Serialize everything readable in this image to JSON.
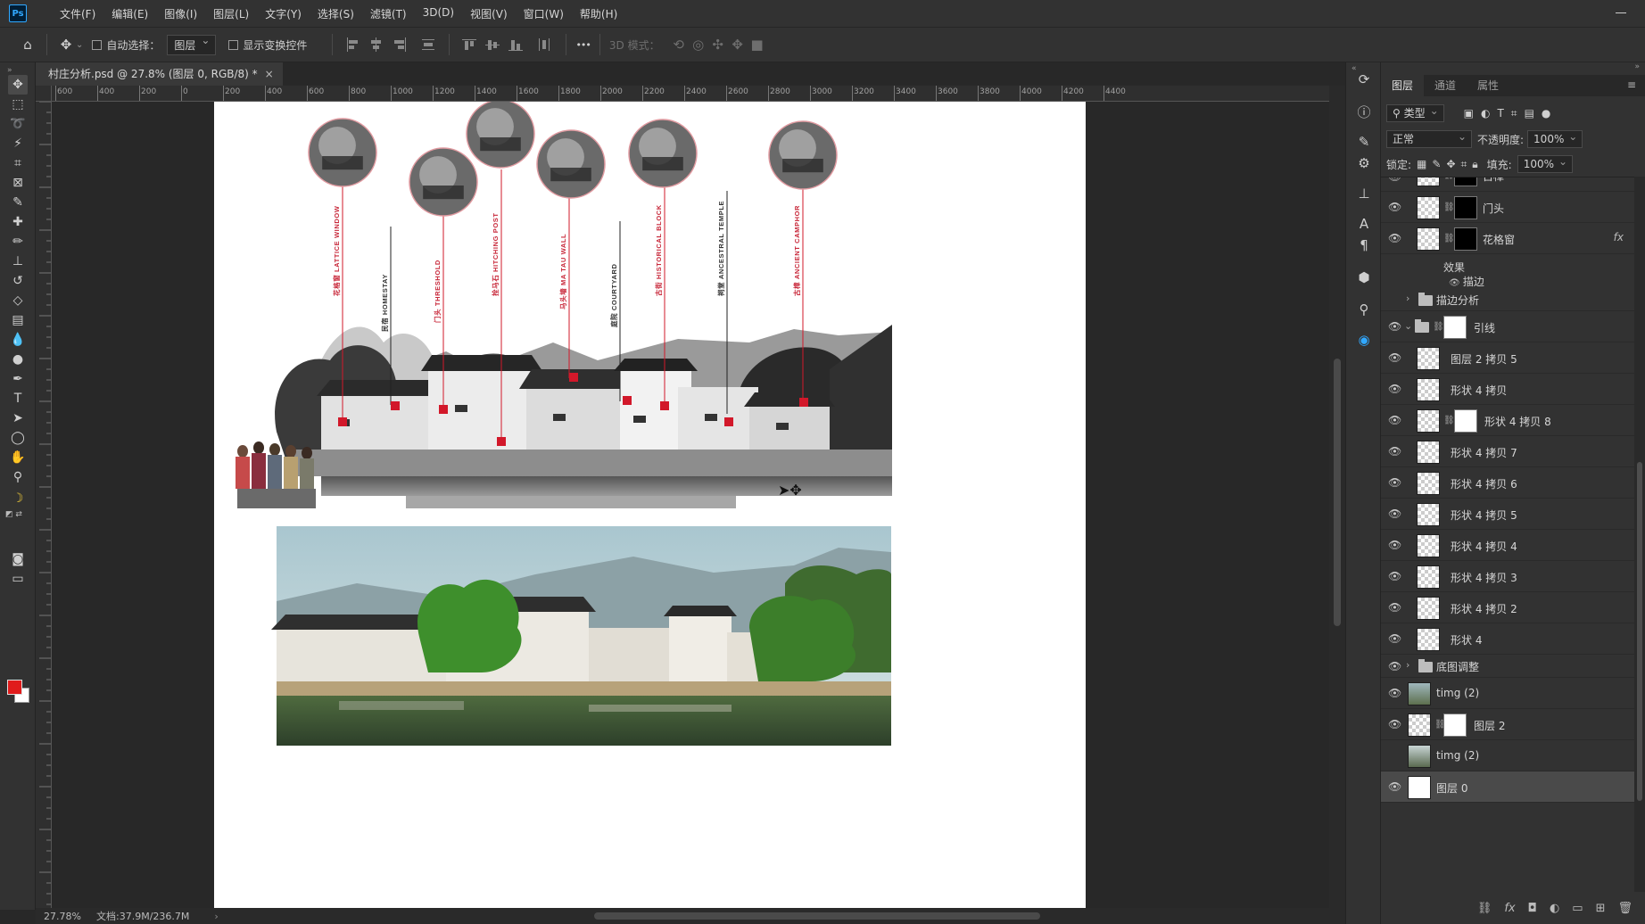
{
  "app": {
    "logo_text": "Ps",
    "menus": [
      "文件(F)",
      "编辑(E)",
      "图像(I)",
      "图层(L)",
      "文字(Y)",
      "选择(S)",
      "滤镜(T)",
      "3D(D)",
      "视图(V)",
      "窗口(W)",
      "帮助(H)"
    ]
  },
  "options_bar": {
    "auto_select_label": "自动选择：",
    "auto_select_target": "图层",
    "show_transform_label": "显示变换控件",
    "mode_3d_label": "3D 模式：",
    "more_label": "•••"
  },
  "document": {
    "tab_title": "村庄分析.psd @ 27.8% (图层 0, RGB/8) *",
    "close_glyph": "×",
    "zoom": "27.78%",
    "doc_size": "文档:37.9M/236.7M"
  },
  "ruler_h_labels": [
    "600",
    "400",
    "200",
    "0",
    "200",
    "400",
    "600",
    "800",
    "1000",
    "1200",
    "1400",
    "1600",
    "1800",
    "2000",
    "2200",
    "2400",
    "2600",
    "2800",
    "3000",
    "3200",
    "3400",
    "3600",
    "3800",
    "4000",
    "4200",
    "4400"
  ],
  "artwork": {
    "labels": [
      {
        "cn": "花格窗",
        "en": "LATTICE WINDOW",
        "color": "#c8283a"
      },
      {
        "cn": "民宿",
        "en": "HOMESTAY",
        "color": "#333333"
      },
      {
        "cn": "门头",
        "en": "THRESHOLD",
        "color": "#c8283a"
      },
      {
        "cn": "拴马石",
        "en": "HITCHING POST",
        "color": "#c8283a"
      },
      {
        "cn": "马头墙",
        "en": "MA TAU WALL",
        "color": "#c8283a"
      },
      {
        "cn": "庭院",
        "en": "COURTYARD",
        "color": "#333333"
      },
      {
        "cn": "古街",
        "en": "HISTORICAL BLOCK",
        "color": "#c8283a"
      },
      {
        "cn": "祠堂",
        "en": "ANCESTRAL TEMPLE",
        "color": "#333333"
      },
      {
        "cn": "古樟",
        "en": "ANCIENT CAMPHOR",
        "color": "#c8283a"
      }
    ]
  },
  "layers_panel": {
    "tabs": [
      "图层",
      "通道",
      "属性"
    ],
    "filter_type": "类型",
    "blend_mode": "正常",
    "opacity_label": "不透明度:",
    "opacity_value": "100%",
    "lock_label": "锁定:",
    "fill_label": "填充:",
    "fill_value": "100%",
    "effects_label": "效果",
    "stroke_label": "描边",
    "fx_label": "fx",
    "layers": [
      {
        "name": "古樟"
      },
      {
        "name": "门头"
      },
      {
        "name": "花格窗"
      },
      {
        "name": "描边分析"
      },
      {
        "name": "引线"
      },
      {
        "name": "图层 2 拷贝 5"
      },
      {
        "name": "形状 4 拷贝"
      },
      {
        "name": "形状 4 拷贝 8"
      },
      {
        "name": "形状 4 拷贝 7"
      },
      {
        "name": "形状 4 拷贝 6"
      },
      {
        "name": "形状 4 拷贝 5"
      },
      {
        "name": "形状 4 拷贝 4"
      },
      {
        "name": "形状 4 拷贝 3"
      },
      {
        "name": "形状 4 拷贝 2"
      },
      {
        "name": "形状 4"
      },
      {
        "name": "底图调整"
      },
      {
        "name": "timg (2)"
      },
      {
        "name": "图层 2"
      },
      {
        "name": "timg (2)"
      },
      {
        "name": "图层 0"
      }
    ]
  },
  "colors": {
    "accent_red": "#d2182a",
    "foreground": "#e01b1b",
    "background": "#ffffff"
  }
}
